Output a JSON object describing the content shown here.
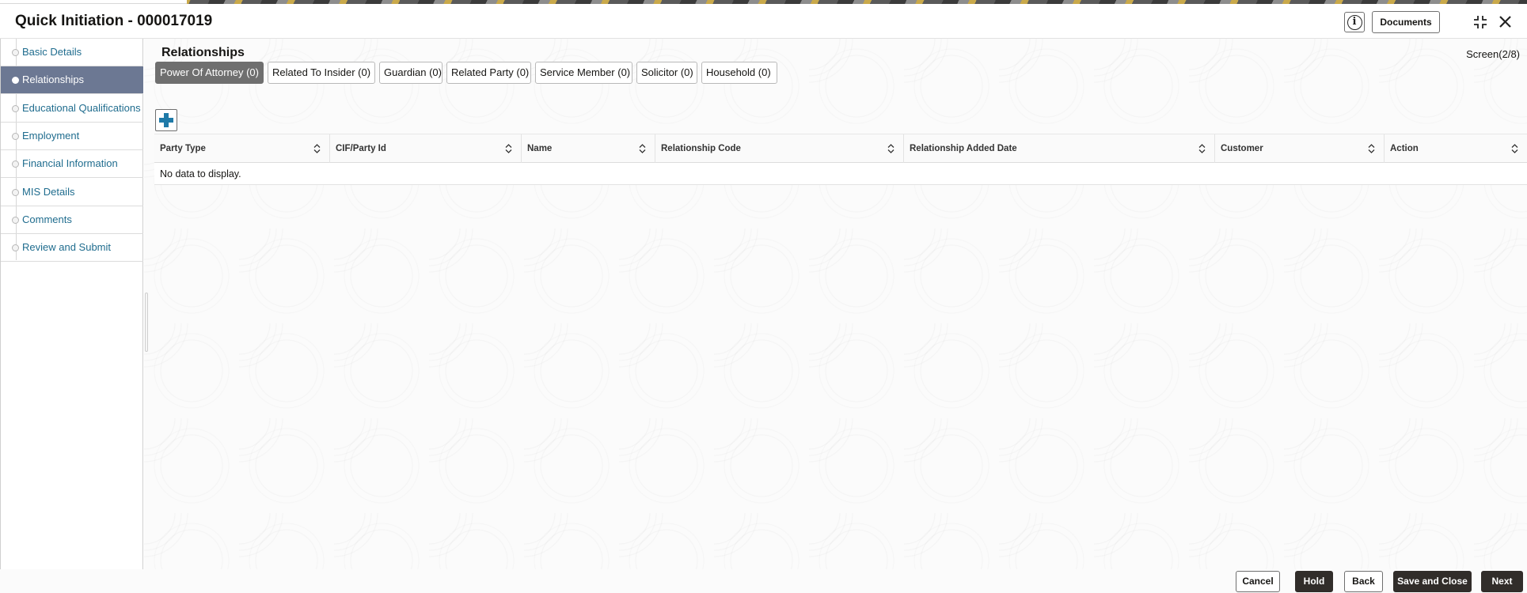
{
  "window": {
    "title": "Quick Initiation - 000017019",
    "documents_label": "Documents",
    "info_icon": "info-icon",
    "collapse_icon": "collapse-icon",
    "close_icon": "close-icon"
  },
  "sidebar": {
    "items": [
      {
        "label": "Basic Details",
        "active": false
      },
      {
        "label": "Relationships",
        "active": true
      },
      {
        "label": "Educational Qualifications",
        "active": false
      },
      {
        "label": "Employment",
        "active": false
      },
      {
        "label": "Financial Information",
        "active": false
      },
      {
        "label": "MIS Details",
        "active": false
      },
      {
        "label": "Comments",
        "active": false
      },
      {
        "label": "Review and Submit",
        "active": false
      }
    ]
  },
  "main": {
    "heading": "Relationships",
    "screen_indicator": "Screen(2/8)",
    "tabs": [
      {
        "label": "Power Of Attorney (0)",
        "active": true
      },
      {
        "label": "Related To Insider (0)",
        "active": false
      },
      {
        "label": "Guardian (0)",
        "active": false
      },
      {
        "label": "Related Party (0)",
        "active": false
      },
      {
        "label": "Service Member (0)",
        "active": false
      },
      {
        "label": "Solicitor (0)",
        "active": false
      },
      {
        "label": "Household (0)",
        "active": false
      }
    ],
    "add_icon": "plus-icon",
    "table": {
      "columns": [
        "Party Type",
        "CIF/Party Id",
        "Name",
        "Relationship Code",
        "Relationship Added Date",
        "Customer",
        "Action"
      ],
      "empty_message": "No data to display."
    }
  },
  "footer": {
    "cancel_label": "Cancel",
    "hold_label": "Hold",
    "back_label": "Back",
    "save_close_label": "Save and Close",
    "next_label": "Next"
  },
  "colors": {
    "active_nav": "#6c7893",
    "nav_link": "#1f6c8e",
    "active_tab": "#6f6f6f",
    "dark_button": "#312d2a",
    "add_icon": "#1f7aa8"
  }
}
